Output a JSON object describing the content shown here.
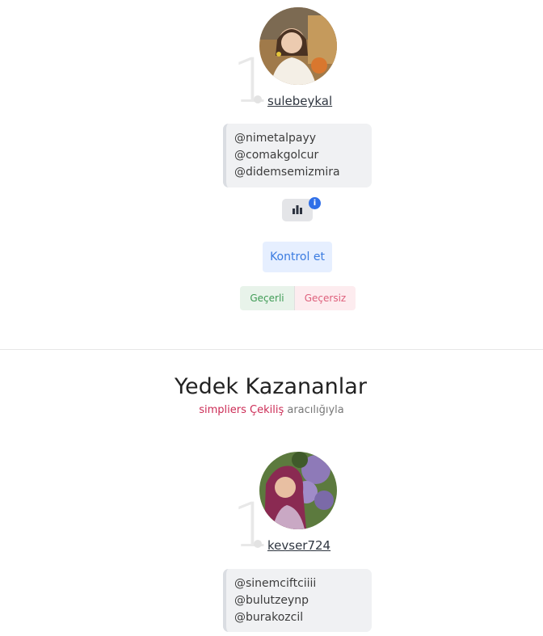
{
  "winner": {
    "rank": "1.",
    "username": "sulebeykal",
    "mentions": [
      "@nimetalpayy",
      "@comakgolcur",
      "@didemsemizmira"
    ],
    "stats_icon": "bar-chart-icon",
    "info_icon": "info-icon",
    "info_glyph": "i",
    "check_label": "Kontrol et",
    "valid_label": "Geçerli",
    "invalid_label": "Geçersiz"
  },
  "backup": {
    "title": "Yedek Kazananlar",
    "subtitle_brand": "simpliers",
    "subtitle_link": "Çekiliş",
    "subtitle_suffix": "aracılığıyla",
    "winner": {
      "rank": "1.",
      "username": "kevser724",
      "mentions": [
        "@sinemciftciiii",
        "@bulutzeynp",
        "@burakozcil"
      ]
    }
  },
  "colors": {
    "brand": "#cc2c56",
    "accent": "#3a7be0",
    "valid": "#3f9b55",
    "invalid": "#de5f7b"
  }
}
